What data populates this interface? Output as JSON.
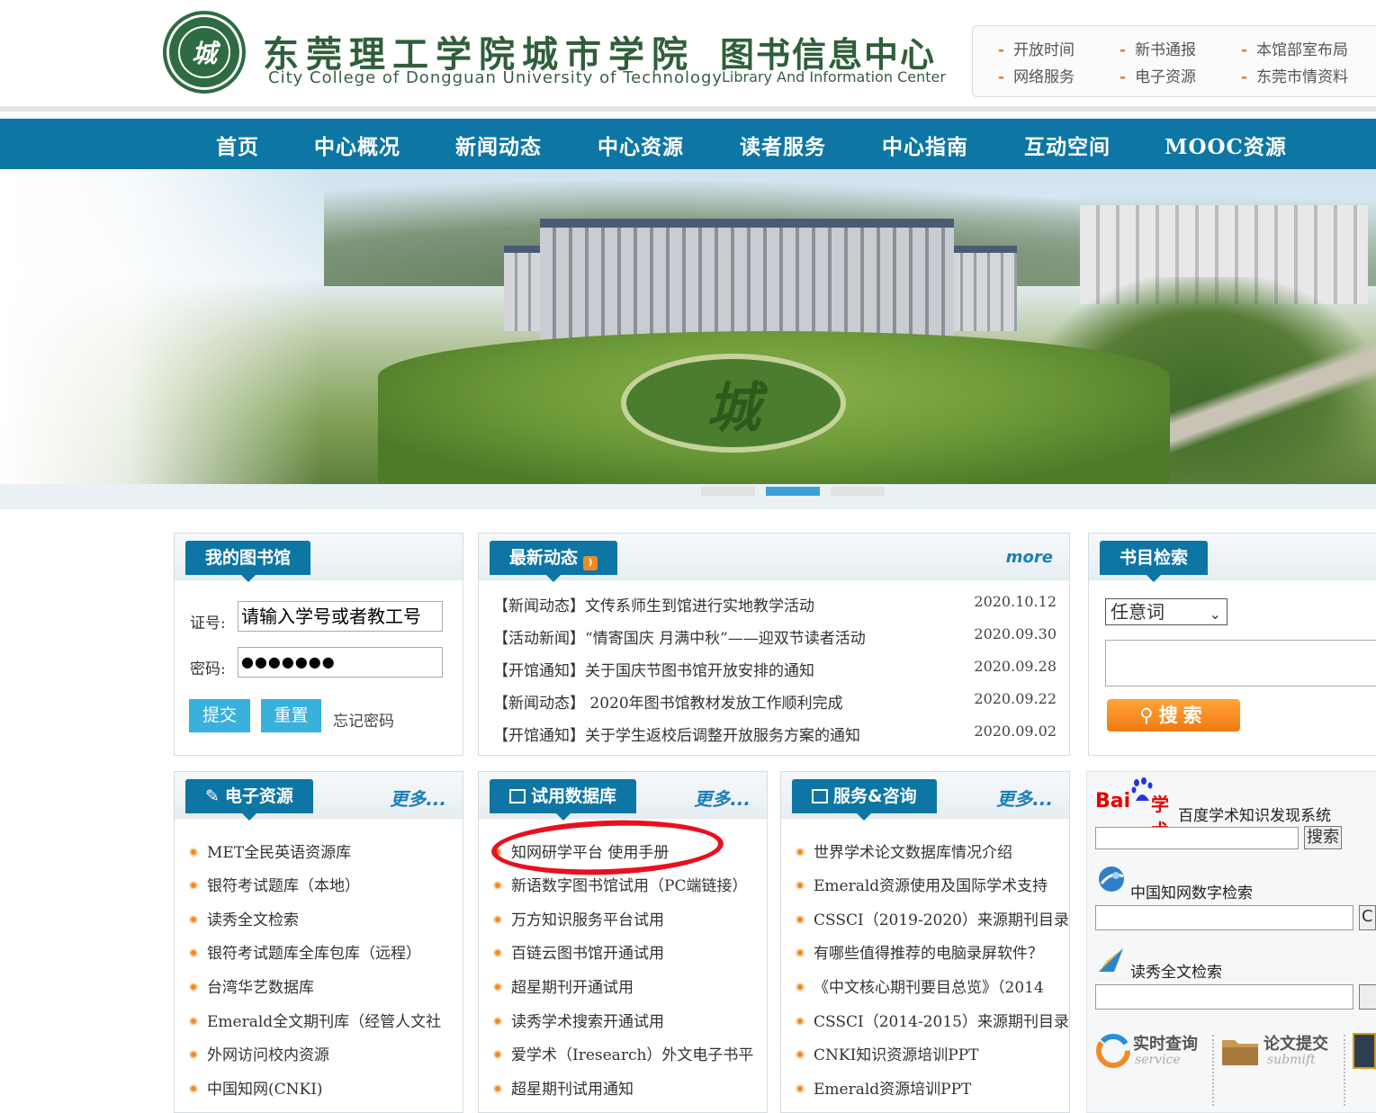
{
  "header": {
    "logo_seal_text": "城",
    "school_cn": "东莞理工学院城市学院",
    "school_en": "City College of Dongguan University of Technology",
    "center_cn": "图书信息中心",
    "center_en": "Library And Information Center",
    "quick_links": [
      "开放时间",
      "新书通报",
      "本馆部室布局",
      "网络服务",
      "电子资源",
      "东莞市情资料"
    ]
  },
  "nav": [
    "首页",
    "中心概况",
    "新闻动态",
    "中心资源",
    "读者服务",
    "中心指南",
    "互动空间",
    "MOOC资源"
  ],
  "banner": {
    "emblem_text": "城",
    "active_slide": 2,
    "slide_count": 3
  },
  "my_library": {
    "title": "我的图书馆",
    "id_label": "证号:",
    "id_value": "请输入学号或者教工号",
    "pwd_label": "密码:",
    "pwd_value": "●●●●●●●",
    "submit": "提交",
    "reset": "重置",
    "forgot": "忘记密码"
  },
  "news": {
    "title": "最新动态",
    "more": "more",
    "items": [
      {
        "text": "【新闻动态】文传系师生到馆进行实地教学活动",
        "date": "2020.10.12"
      },
      {
        "text": "【活动新闻】“情寄国庆 月满中秋”——迎双节读者活动",
        "date": "2020.09.30"
      },
      {
        "text": "【开馆通知】关于国庆节图书馆开放安排的通知",
        "date": "2020.09.28"
      },
      {
        "text": "【新闻动态】 2020年图书馆教材发放工作顺利完成",
        "date": "2020.09.22"
      },
      {
        "text": "【开馆通知】关于学生返校后调整开放服务方案的通知",
        "date": "2020.09.02"
      }
    ]
  },
  "catalog": {
    "title": "书目检索",
    "select_value": "任意词",
    "search": "搜索"
  },
  "eresources": {
    "title": "电子资源",
    "more": "更多...",
    "items": [
      "MET全民英语资源库",
      "银符考试题库（本地）",
      "读秀全文检索",
      "银符考试题库全库包库（远程）",
      "台湾华艺数据库",
      "Emerald全文期刊库（经管人文社",
      "外网访问校内资源",
      "中国知网(CNKI)"
    ]
  },
  "trial_db": {
    "title": "试用数据库",
    "more": "更多...",
    "items": [
      "知网研学平台 使用手册",
      "新语数字图书馆试用（PC端链接）",
      "万方知识服务平台试用",
      "百链云图书馆开通试用",
      "超星期刊开通试用",
      "读秀学术搜索开通试用",
      "爱学术（Iresearch）外文电子书平",
      "超星期刊试用通知"
    ]
  },
  "service": {
    "title": "服务&咨询",
    "more": "更多...",
    "items": [
      "世界学术论文数据库情况介绍",
      "Emerald资源使用及国际学术支持",
      "CSSCI（2019-2020）来源期刊目录",
      "有哪些值得推荐的电脑录屏软件？",
      "《中文核心期刊要目总览》（2014",
      "CSSCI（2014-2015）来源期刊目录",
      "CNKI知识资源培训PPT",
      "Emerald资源培训PPT"
    ]
  },
  "right_widgets": {
    "baidu_logo_bai": "Bai",
    "baidu_logo_xs": "学术",
    "baidu_title": "百度学术知识发现系统",
    "baidu_btn": "搜索",
    "cnki_title": "中国知网数字检索",
    "cnki_btn": "C",
    "duxiu_title": "读秀全文检索",
    "realtime_cn": "实时查询",
    "realtime_en": "service",
    "submit_cn": "论文提交",
    "submit_en": "submift"
  },
  "colors": {
    "brand_blue": "#0d76a4",
    "accent_orange": "#f08a24",
    "header_green": "#2f5f3a",
    "annotation_red": "#e8101e"
  }
}
